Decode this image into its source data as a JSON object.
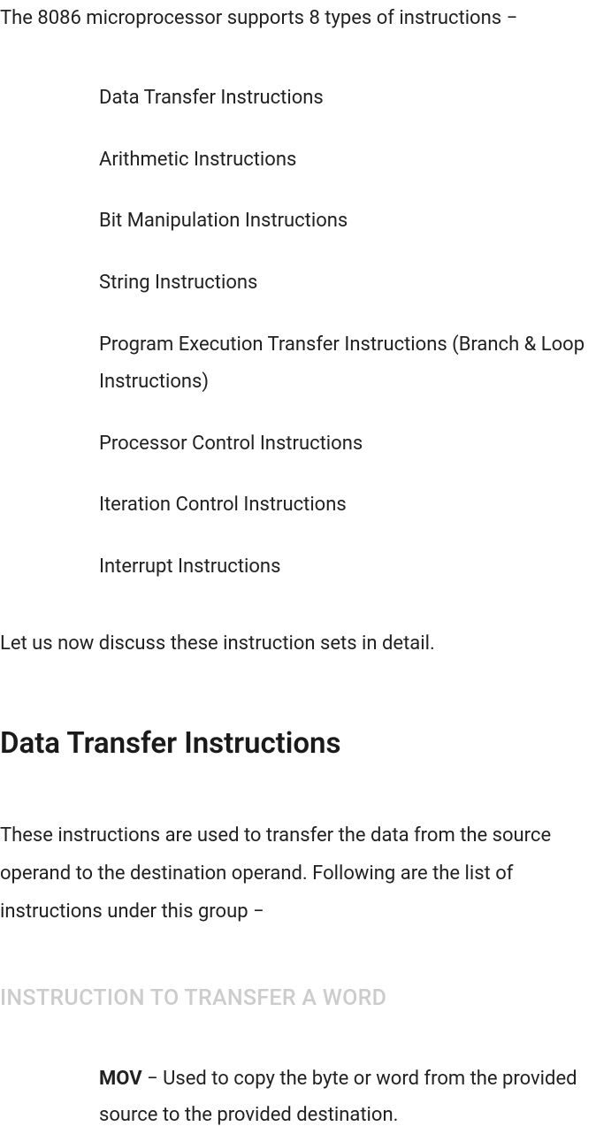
{
  "intro": "The 8086 microprocessor supports 8 types of instructions −",
  "instructionTypes": [
    "Data Transfer Instructions",
    "Arithmetic Instructions",
    "Bit Manipulation Instructions",
    "String Instructions",
    "Program Execution Transfer Instructions (Branch & Loop Instructions)",
    "Processor Control Instructions",
    "Iteration Control Instructions",
    "Interrupt Instructions"
  ],
  "discussText": "Let us now discuss these instruction sets in detail.",
  "section": {
    "heading": "Data Transfer Instructions",
    "description": "These instructions are used to transfer the data from the source operand to the destination operand. Following are the list of instructions under this group −",
    "subheading": "INSTRUCTION TO TRANSFER A WORD",
    "definitions": [
      {
        "term": "MOV",
        "desc": " − Used to copy the byte or word from the provided source to the provided destination."
      }
    ]
  }
}
